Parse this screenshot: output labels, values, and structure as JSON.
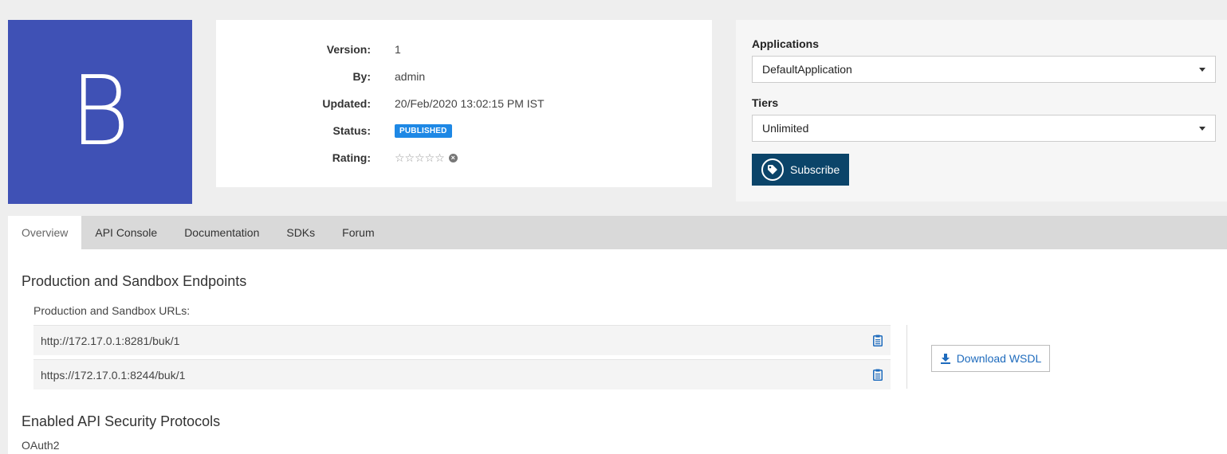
{
  "api": {
    "thumbnail_letter": "B",
    "thumbnail_color": "#3f51b5"
  },
  "info": {
    "version_label": "Version:",
    "version_value": "1",
    "by_label": "By:",
    "by_value": "admin",
    "updated_label": "Updated:",
    "updated_value": "20/Feb/2020 13:02:15 PM IST",
    "status_label": "Status:",
    "status_value": "PUBLISHED",
    "status_color": "#1e88e5",
    "rating_label": "Rating:",
    "rating_stars": "☆☆☆☆☆",
    "rating_value": 0,
    "rating_max": 5
  },
  "subscription": {
    "applications_label": "Applications",
    "application_selected": "DefaultApplication",
    "tiers_label": "Tiers",
    "tier_selected": "Unlimited",
    "subscribe_label": "Subscribe",
    "subscribe_color": "#0b4469"
  },
  "tabs": [
    {
      "label": "Overview",
      "active": true
    },
    {
      "label": "API Console",
      "active": false
    },
    {
      "label": "Documentation",
      "active": false
    },
    {
      "label": "SDKs",
      "active": false
    },
    {
      "label": "Forum",
      "active": false
    }
  ],
  "endpoints": {
    "title": "Production and Sandbox Endpoints",
    "urls_label": "Production and Sandbox URLs:",
    "urls": [
      "http://172.17.0.1:8281/buk/1",
      "https://172.17.0.1:8244/buk/1"
    ],
    "download_label": "Download WSDL"
  },
  "security": {
    "title": "Enabled API Security Protocols",
    "protocol": "OAuth2"
  },
  "icons": {
    "subscribe": "tag-icon",
    "copy": "clipboard-icon",
    "download": "download-icon",
    "clear_rating": "close-circle-icon",
    "select_caret": "caret-down-icon"
  }
}
